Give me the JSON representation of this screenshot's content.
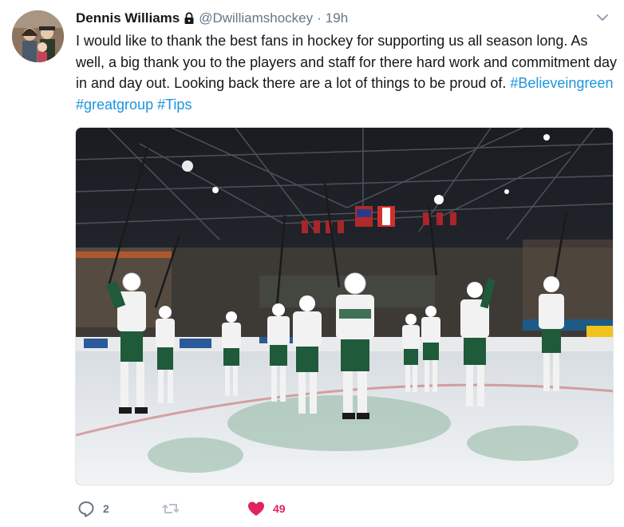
{
  "tweet": {
    "author_name": "Dennis Williams",
    "handle": "@Dwilliamshockey",
    "separator": "·",
    "time": "19h",
    "text_parts": [
      "I would like to thank the best fans in hockey for supporting us all season long. As well, a big thank you to the players and staff for there hard work and commitment day in and day out. Looking back there are a lot of things to be proud of. "
    ],
    "hashtags": [
      "#Believeingreen",
      "#greatgroup",
      "#Tips"
    ],
    "media": {
      "banner_flags": [
        "US flag",
        "Canada flag"
      ]
    }
  },
  "actions": {
    "reply_count": "2",
    "retweet_count": "",
    "like_count": "49"
  },
  "colors": {
    "link": "#1b95e0",
    "like": "#e0245e",
    "muted": "#657786",
    "jersey_green": "#1f5a3a"
  },
  "icons": [
    "lock-icon",
    "caret-down-icon",
    "reply-icon",
    "retweet-icon",
    "heart-icon"
  ]
}
